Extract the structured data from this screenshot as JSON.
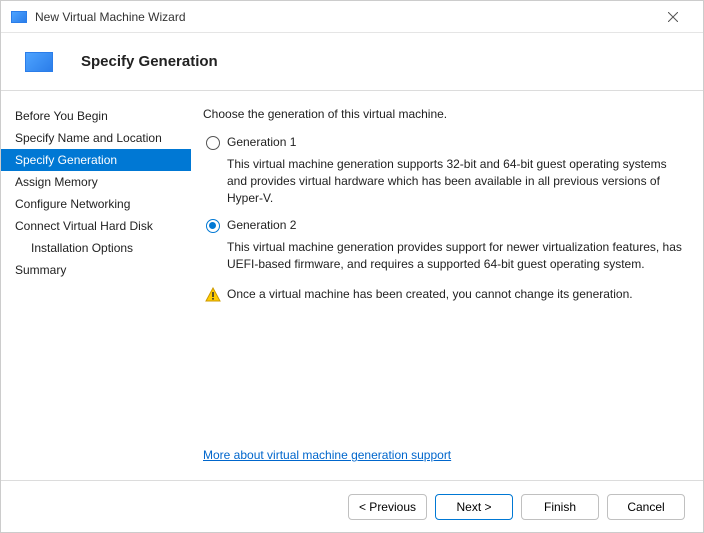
{
  "titlebar": {
    "title": "New Virtual Machine Wizard"
  },
  "header": {
    "title": "Specify Generation"
  },
  "sidebar": {
    "items": [
      {
        "label": "Before You Begin",
        "active": false,
        "indent": false
      },
      {
        "label": "Specify Name and Location",
        "active": false,
        "indent": false
      },
      {
        "label": "Specify Generation",
        "active": true,
        "indent": false
      },
      {
        "label": "Assign Memory",
        "active": false,
        "indent": false
      },
      {
        "label": "Configure Networking",
        "active": false,
        "indent": false
      },
      {
        "label": "Connect Virtual Hard Disk",
        "active": false,
        "indent": false
      },
      {
        "label": "Installation Options",
        "active": false,
        "indent": true
      },
      {
        "label": "Summary",
        "active": false,
        "indent": false
      }
    ]
  },
  "content": {
    "intro": "Choose the generation of this virtual machine.",
    "gen1_label": "Generation 1",
    "gen1_desc": "This virtual machine generation supports 32-bit and 64-bit guest operating systems and provides virtual hardware which has been available in all previous versions of Hyper-V.",
    "gen2_label": "Generation 2",
    "gen2_desc": "This virtual machine generation provides support for newer virtualization features, has UEFI-based firmware, and requires a supported 64-bit guest operating system.",
    "warning": "Once a virtual machine has been created, you cannot change its generation.",
    "more_link": "More about virtual machine generation support"
  },
  "footer": {
    "previous": "< Previous",
    "next": "Next >",
    "finish": "Finish",
    "cancel": "Cancel"
  }
}
